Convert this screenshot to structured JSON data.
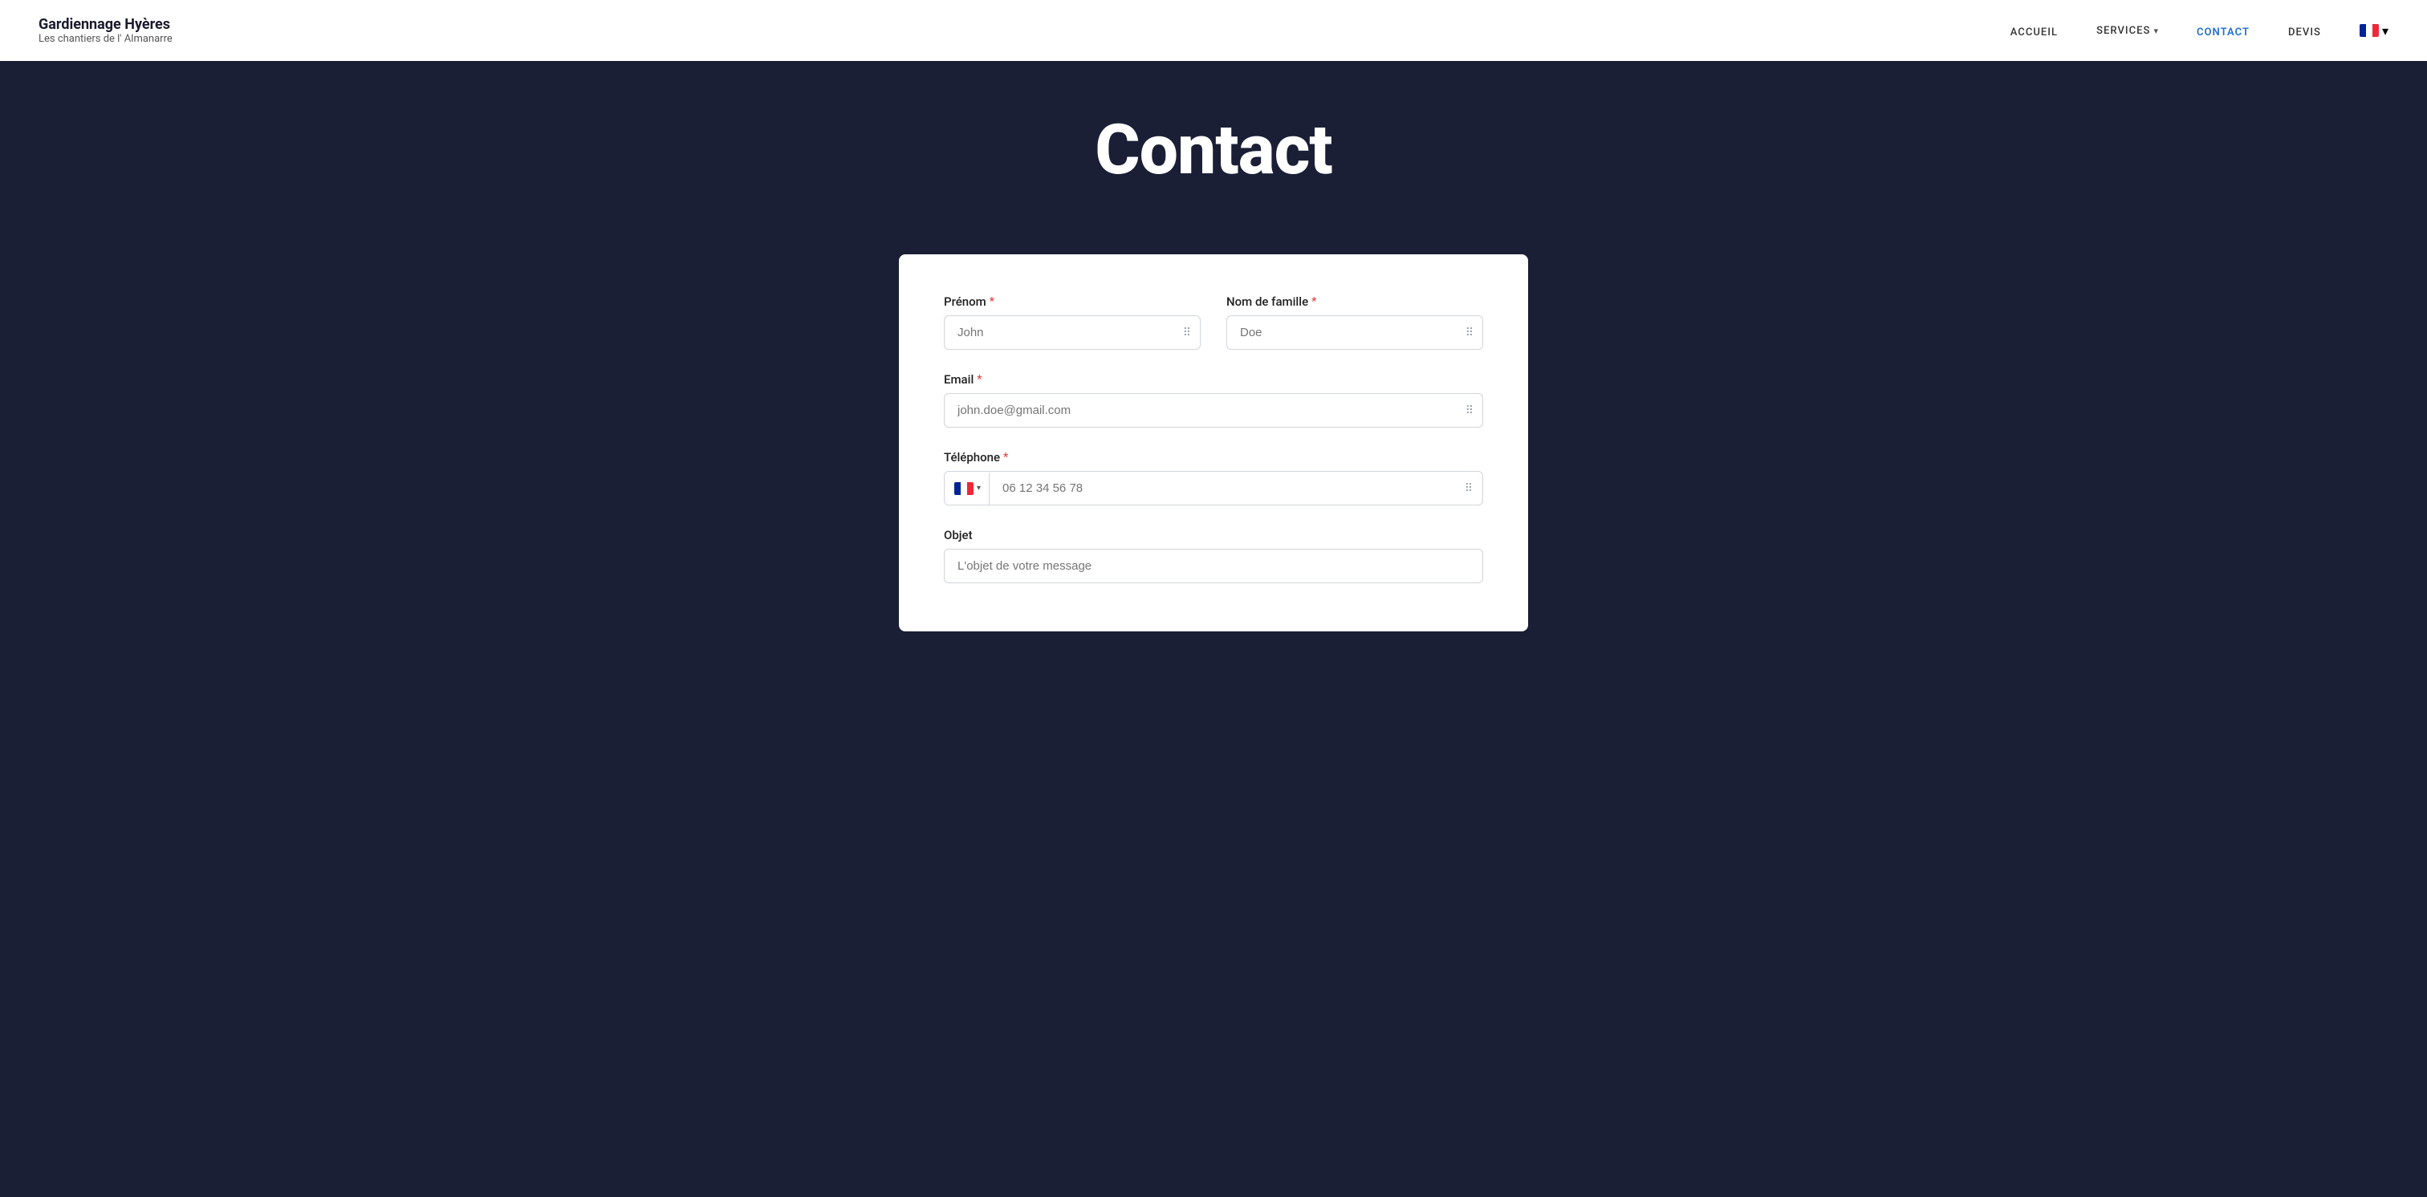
{
  "navbar": {
    "brand_title": "Gardiennage Hyères",
    "brand_subtitle": "Les chantiers de l' Almanarre",
    "nav_items": [
      {
        "id": "accueil",
        "label": "ACCUEIL",
        "active": false
      },
      {
        "id": "services",
        "label": "SERVICES",
        "active": false,
        "has_dropdown": true
      },
      {
        "id": "contact",
        "label": "CONTACT",
        "active": true
      },
      {
        "id": "devis",
        "label": "DEVIS",
        "active": false
      }
    ],
    "language": "FR",
    "language_chevron": "▾"
  },
  "hero": {
    "title": "Contact"
  },
  "form": {
    "prenom_label": "Prénom",
    "prenom_placeholder": "John",
    "nom_label": "Nom de famille",
    "nom_placeholder": "Doe",
    "email_label": "Email",
    "email_placeholder": "john.doe@gmail.com",
    "telephone_label": "Téléphone",
    "telephone_placeholder": "06 12 34 56 78",
    "objet_label": "Objet",
    "objet_placeholder": "L'objet de votre message",
    "required_symbol": "*"
  },
  "icons": {
    "input_handle": "⠿",
    "chevron_down": "▾",
    "services_chevron": "▾"
  }
}
